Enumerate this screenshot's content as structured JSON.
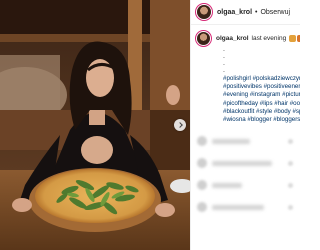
{
  "post": {
    "username": "olgaa_krol",
    "separator": "•",
    "follow_label": "Obserwuj",
    "caption_user": "olgaa_krol",
    "caption_text": "last evening",
    "caption_dots": [
      ".",
      ".",
      ".",
      "."
    ],
    "hashtags": [
      "#polishgirl #polskadziewczyna",
      "#positivevibes #positiveenergy",
      "#evening #instagram #pictureo",
      "#picoftheday #lips #hair #ootd",
      "#blackoutfit #style #body #spri",
      "#wiosna #blogger #bloggerstyl"
    ]
  },
  "icons": {
    "next": "chevron-right-icon",
    "avatar": "profile-avatar"
  },
  "colors": {
    "hashtag": "#003569",
    "story_ring": "#d62976",
    "border": "#efefef"
  }
}
